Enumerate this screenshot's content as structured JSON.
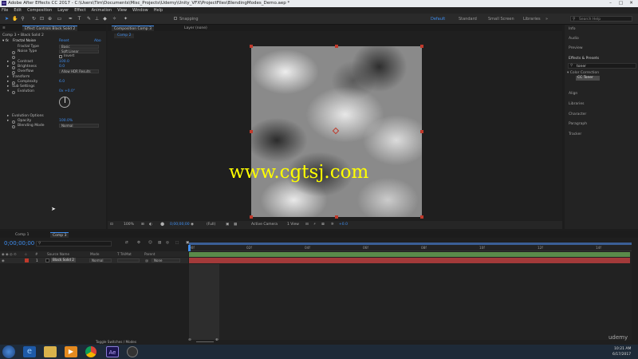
{
  "window": {
    "title": "Adobe After Effects CC 2017 - C:\\Users\\Tim\\Documents\\Misc_Projects\\Udemy\\Unity_VFX\\ProjectFiles\\BlendingModes_Demo.aep *"
  },
  "menu": [
    "File",
    "Edit",
    "Composition",
    "Layer",
    "Effect",
    "Animation",
    "View",
    "Window",
    "Help"
  ],
  "toolbar": {
    "snapping": "Snapping",
    "workspaces": [
      "Default",
      "Standard",
      "Small Screen",
      "Libraries"
    ],
    "search_placeholder": "Search Help"
  },
  "effect_controls": {
    "tab_label": "Effect Controls Black Solid 2",
    "header": "Comp 3 • Black Solid 2",
    "effect_name": "Fractal Noise",
    "reset": "Reset",
    "about": "Abo",
    "props": [
      {
        "label": "Fractal Type",
        "value": "Basic"
      },
      {
        "label": "Noise Type",
        "value": "Soft Linear"
      },
      {
        "label": "",
        "value": "Invert"
      },
      {
        "label": "Contrast",
        "value": "100.0"
      },
      {
        "label": "Brightness",
        "value": "0.0"
      },
      {
        "label": "Overflow",
        "value": "Allow HDR Results"
      },
      {
        "label": "Transform",
        "value": ""
      },
      {
        "label": "Complexity",
        "value": "6.0"
      },
      {
        "label": "Sub Settings",
        "value": ""
      },
      {
        "label": "Evolution",
        "value": "0x +0.0°"
      },
      {
        "label": "Evolution Options",
        "value": ""
      },
      {
        "label": "Opacity",
        "value": "100.0%"
      },
      {
        "label": "Blending Mode",
        "value": "Normal"
      }
    ]
  },
  "composition": {
    "tab_label": "Composition Comp 3",
    "layer_tab": "Layer (none)",
    "subtab": "Comp 2",
    "watermark": "www.cgtsj.com",
    "zoom": "100%",
    "resolution": "(Full)",
    "camera": "Active Camera",
    "view": "1 View",
    "exposure": "+0.0"
  },
  "right_panel": {
    "items": [
      "Info",
      "Audio",
      "Preview",
      "Effects & Presets"
    ],
    "search": "toner",
    "category": "Color Correction",
    "effect": "CC Toner",
    "lower_items": [
      "Align",
      "Libraries",
      "Character",
      "Paragraph",
      "Tracker"
    ]
  },
  "timeline": {
    "tabs": [
      "Comp 1",
      "Comp 3"
    ],
    "timecode": "0;00;00;00",
    "columns": [
      "Source Name",
      "Mode",
      "T TrkMat",
      "Parent"
    ],
    "layer": {
      "index": "1",
      "name": "Black Solid 2",
      "mode": "Normal",
      "parent": "None"
    },
    "ruler_marks": [
      "00f",
      "02f",
      "04f",
      "06f",
      "08f",
      "10f",
      "12f",
      "14f"
    ],
    "toggle_label": "Toggle Switches / Modes"
  },
  "taskbar": {
    "time": "10:21 AM",
    "date": "6/17/2017",
    "brand": "udemy"
  },
  "colors": {
    "accent": "#3f8ef0",
    "watermark": "#ffff00",
    "layer_bar": "#a33a3a",
    "layer_bar_top": "#5a8a4a"
  }
}
